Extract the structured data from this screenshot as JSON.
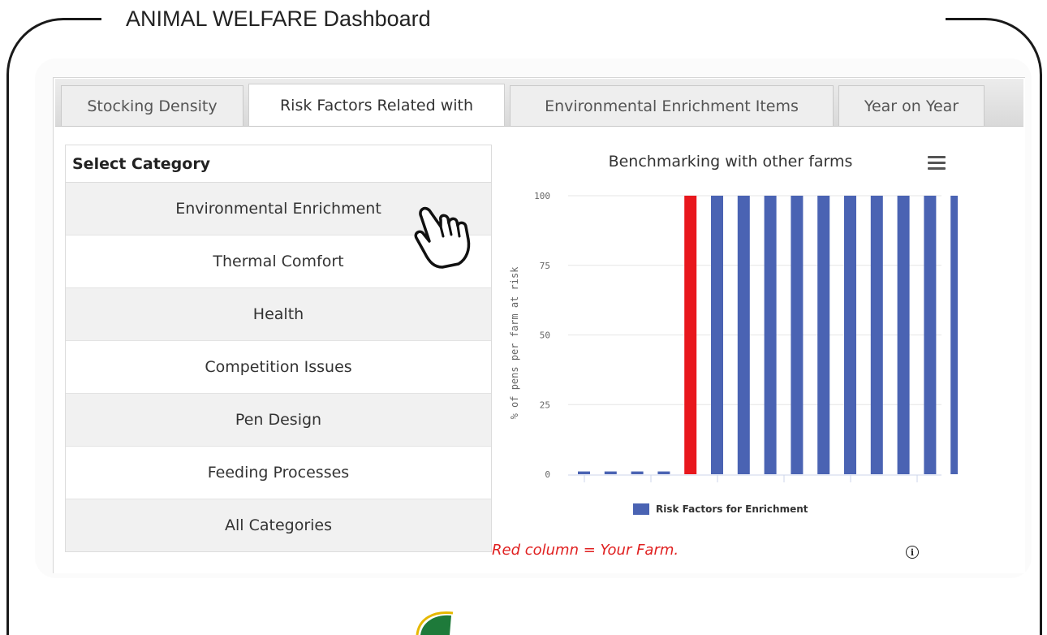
{
  "page": {
    "title": "ANIMAL WELFARE Dashboard"
  },
  "tabs": [
    {
      "label": "Stocking Density",
      "active": false
    },
    {
      "label": "Risk Factors Related with",
      "active": true
    },
    {
      "label": "Environmental Enrichment Items",
      "active": false
    },
    {
      "label": "Year on Year",
      "active": false
    }
  ],
  "category_panel": {
    "header": "Select Category",
    "items": [
      "Environmental Enrichment",
      "Thermal Comfort",
      "Health",
      "Competition Issues",
      "Pen Design",
      "Feeding Processes",
      "All Categories"
    ]
  },
  "chart": {
    "title": "Benchmarking with other farms",
    "note": "Red column = Your Farm.",
    "icons": {
      "menu": "hamburger-menu-icon",
      "info": "info-icon",
      "pointer": "hand-pointer-icon"
    }
  },
  "chart_data": {
    "type": "bar",
    "ylabel": "% of pens per farm at risk",
    "ylim": [
      0,
      100
    ],
    "yticks": [
      0,
      25,
      50,
      75,
      100
    ],
    "grid": true,
    "legend_position": "bottom",
    "series": [
      {
        "name": "Risk Factors for Enrichment",
        "color": "#4a63b3",
        "values": [
          1,
          1,
          1,
          1,
          100,
          100,
          100,
          100,
          100,
          100,
          100,
          100,
          100,
          100,
          100
        ],
        "highlight_index": 4,
        "highlight_color": "#e8171d"
      }
    ]
  }
}
